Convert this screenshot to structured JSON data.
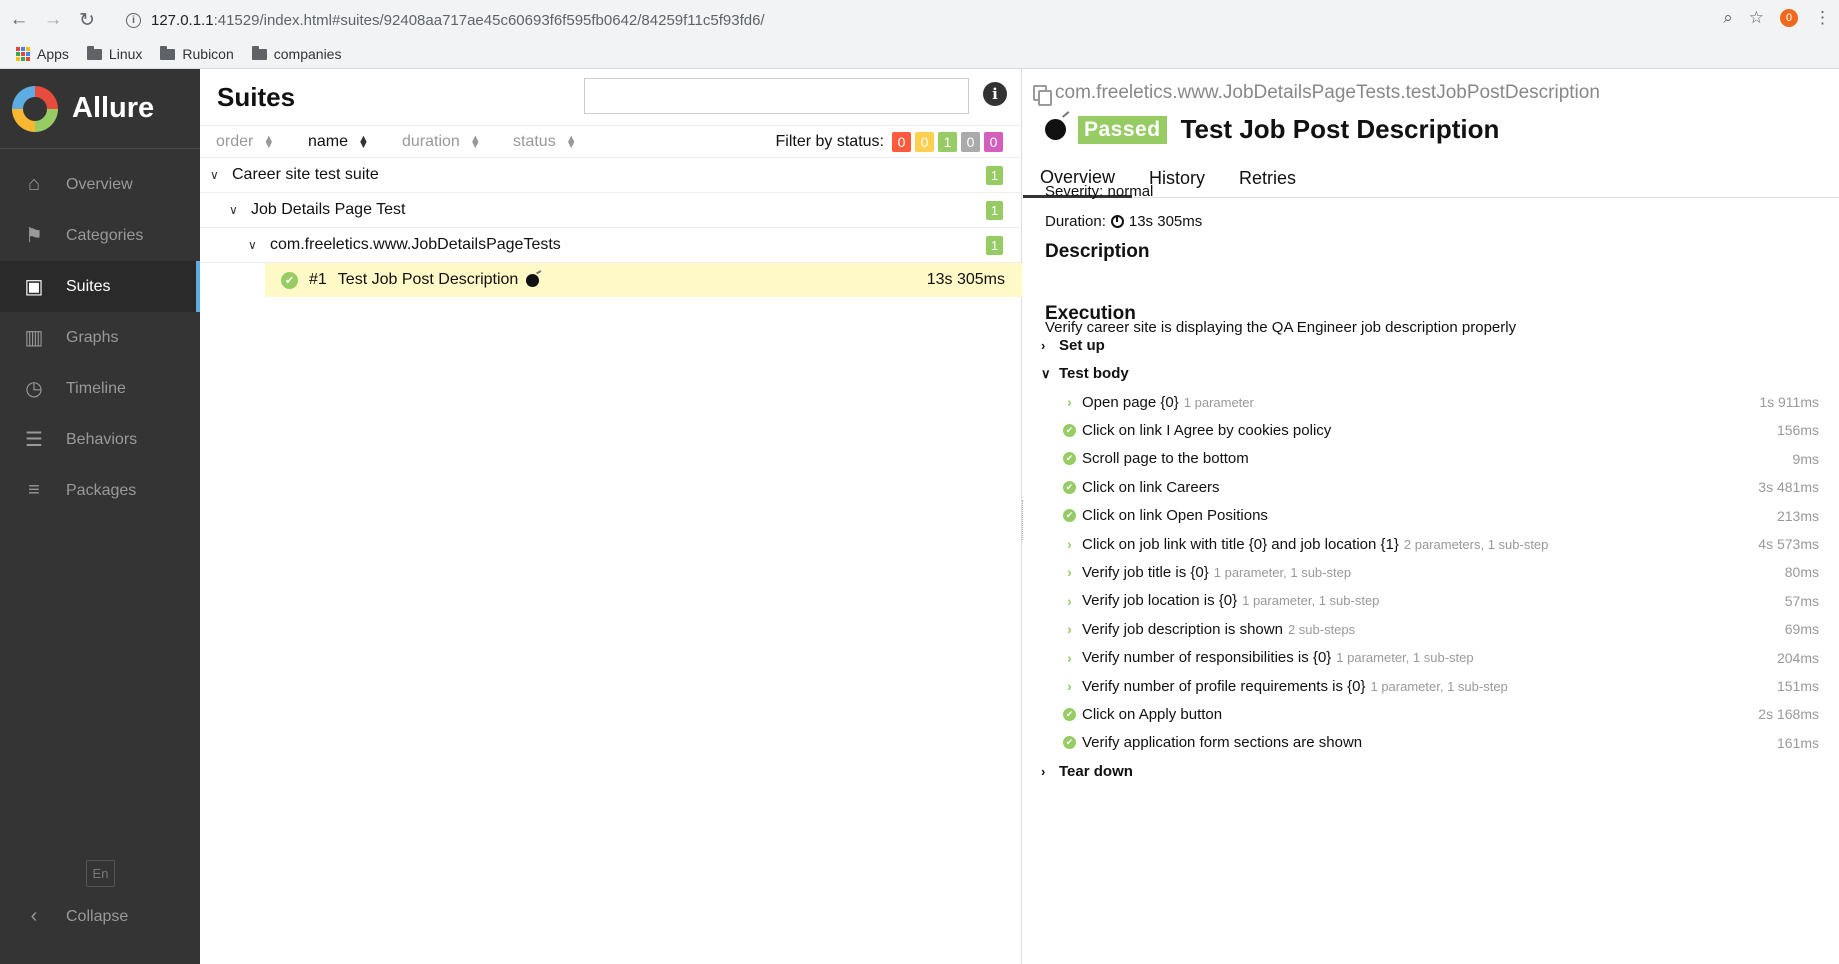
{
  "browser": {
    "url_host": "127.0.1.1",
    "url_rest": ":41529/index.html#suites/92408aa717ae45c60693f6f595fb0642/84259f11c5f93fd6/",
    "extension_badge": "0",
    "bookmarks": [
      "Apps",
      "Linux",
      "Rubicon",
      "companies"
    ]
  },
  "sidebar": {
    "brand": "Allure",
    "items": [
      {
        "label": "Overview",
        "icon": "home-icon"
      },
      {
        "label": "Categories",
        "icon": "flag-icon"
      },
      {
        "label": "Suites",
        "icon": "briefcase-icon"
      },
      {
        "label": "Graphs",
        "icon": "bar-chart-icon"
      },
      {
        "label": "Timeline",
        "icon": "clock-icon"
      },
      {
        "label": "Behaviors",
        "icon": "list-icon"
      },
      {
        "label": "Packages",
        "icon": "align-left-icon"
      }
    ],
    "active": "Suites",
    "language": "En",
    "collapse": "Collapse"
  },
  "suites": {
    "title": "Suites",
    "sort": {
      "order": "order",
      "name": "name",
      "duration": "duration",
      "status": "status"
    },
    "filter_label": "Filter by status:",
    "filter_counts": [
      {
        "value": "0",
        "color": "#fd5a3e"
      },
      {
        "value": "0",
        "color": "#ffd050"
      },
      {
        "value": "1",
        "color": "#97cc64"
      },
      {
        "value": "0",
        "color": "#aaaaaa"
      },
      {
        "value": "0",
        "color": "#d35ebe"
      }
    ],
    "tree": [
      {
        "label": "Career site test suite",
        "count": "1"
      },
      {
        "label": "Job Details Page Test",
        "count": "1"
      },
      {
        "label": "com.freeletics.www.JobDetailsPageTests",
        "count": "1"
      }
    ],
    "test": {
      "index": "#1",
      "name": "Test Job Post Description",
      "duration": "13s 305ms"
    }
  },
  "detail": {
    "breadcrumb": "com.freeletics.www.JobDetailsPageTests.testJobPostDescription",
    "status": "Passed",
    "title": "Test Job Post Description",
    "tabs": [
      "Overview",
      "History",
      "Retries"
    ],
    "severity": "Severity: normal",
    "duration_label": "Duration:",
    "duration": "13s 305ms",
    "description_heading": "Description",
    "description": "Verify career site is displaying the QA Engineer job description properly",
    "execution_heading": "Execution",
    "setup": "Set up",
    "test_body": "Test body",
    "teardown": "Tear down",
    "steps": [
      {
        "name": "Open page {0}",
        "sub": "1 parameter",
        "duration": "1s 911ms",
        "kind": "arrow"
      },
      {
        "name": "Click on link I Agree by cookies policy",
        "sub": "",
        "duration": "156ms",
        "kind": "ok"
      },
      {
        "name": "Scroll page to the bottom",
        "sub": "",
        "duration": "9ms",
        "kind": "ok"
      },
      {
        "name": "Click on link Careers",
        "sub": "",
        "duration": "3s 481ms",
        "kind": "ok"
      },
      {
        "name": "Click on link Open Positions",
        "sub": "",
        "duration": "213ms",
        "kind": "ok"
      },
      {
        "name": "Click on job link with title {0} and job location {1}",
        "sub": "2 parameters, 1 sub-step",
        "duration": "4s 573ms",
        "kind": "arrow"
      },
      {
        "name": "Verify job title is {0}",
        "sub": "1 parameter, 1 sub-step",
        "duration": "80ms",
        "kind": "arrow"
      },
      {
        "name": "Verify job location is {0}",
        "sub": "1 parameter, 1 sub-step",
        "duration": "57ms",
        "kind": "arrow"
      },
      {
        "name": "Verify job description is shown",
        "sub": "2 sub-steps",
        "duration": "69ms",
        "kind": "arrow"
      },
      {
        "name": "Verify number of responsibilities is {0}",
        "sub": "1 parameter, 1 sub-step",
        "duration": "204ms",
        "kind": "arrow"
      },
      {
        "name": "Verify number of profile requirements is {0}",
        "sub": "1 parameter, 1 sub-step",
        "duration": "151ms",
        "kind": "arrow"
      },
      {
        "name": "Click on Apply button",
        "sub": "",
        "duration": "2s 168ms",
        "kind": "ok"
      },
      {
        "name": "Verify application form sections are shown",
        "sub": "",
        "duration": "161ms",
        "kind": "ok"
      }
    ]
  }
}
